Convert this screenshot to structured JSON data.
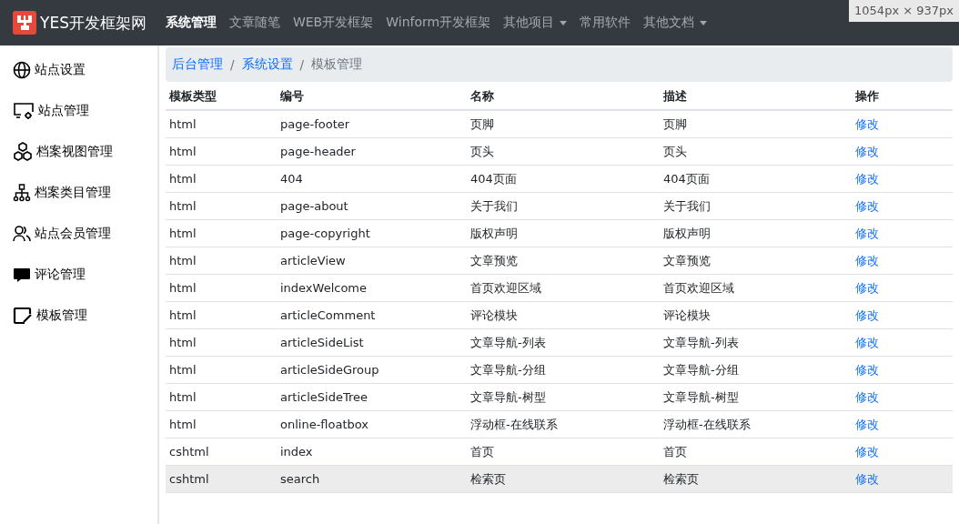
{
  "navbar": {
    "brand": "YES开发框架网",
    "items": [
      {
        "label": "系统管理",
        "selected": true,
        "dropdown": false
      },
      {
        "label": "文章随笔",
        "selected": false,
        "dropdown": false
      },
      {
        "label": "WEB开发框架",
        "selected": false,
        "dropdown": false
      },
      {
        "label": "Winform开发框架",
        "selected": false,
        "dropdown": false
      },
      {
        "label": "其他项目",
        "selected": false,
        "dropdown": true
      },
      {
        "label": "常用软件",
        "selected": false,
        "dropdown": false
      },
      {
        "label": "其他文档",
        "selected": false,
        "dropdown": true
      }
    ]
  },
  "size_tooltip": "1054px × 937px",
  "sidebar": {
    "items": [
      {
        "label": "站点设置",
        "kind": "globe"
      },
      {
        "label": "站点管理",
        "kind": "monitor"
      },
      {
        "label": "档案视图管理",
        "kind": "hexagons"
      },
      {
        "label": "档案类目管理",
        "kind": "tree"
      },
      {
        "label": "站点会员管理",
        "kind": "people"
      },
      {
        "label": "评论管理",
        "kind": "comment"
      },
      {
        "label": "模板管理",
        "kind": "edit"
      }
    ]
  },
  "breadcrumb": [
    {
      "label": "后台管理",
      "link": true
    },
    {
      "separator": "/",
      "label": "系统设置",
      "link": true
    },
    {
      "separator": "/",
      "label": "模板管理",
      "link": false
    }
  ],
  "table": {
    "columns": [
      "模板类型",
      "编号",
      "名称",
      "描述",
      "操作"
    ],
    "rows": [
      {
        "cells": [
          "html",
          "page-footer",
          "页脚",
          "页脚"
        ],
        "action": "修改",
        "selected": false
      },
      {
        "cells": [
          "html",
          "page-header",
          "页头",
          "页头"
        ],
        "action": "修改",
        "selected": false
      },
      {
        "cells": [
          "html",
          "404",
          "404页面",
          "404页面"
        ],
        "action": "修改",
        "selected": false
      },
      {
        "cells": [
          "html",
          "page-about",
          "关于我们",
          "关于我们"
        ],
        "action": "修改",
        "selected": false
      },
      {
        "cells": [
          "html",
          "page-copyright",
          "版权声明",
          "版权声明"
        ],
        "action": "修改",
        "selected": false
      },
      {
        "cells": [
          "html",
          "articleView",
          "文章预览",
          "文章预览"
        ],
        "action": "修改",
        "selected": false
      },
      {
        "cells": [
          "html",
          "indexWelcome",
          "首页欢迎区域",
          "首页欢迎区域"
        ],
        "action": "修改",
        "selected": false
      },
      {
        "cells": [
          "html",
          "articleComment",
          "评论模块",
          "评论模块"
        ],
        "action": "修改",
        "selected": false
      },
      {
        "cells": [
          "html",
          "articleSideList",
          "文章导航-列表",
          "文章导航-列表"
        ],
        "action": "修改",
        "selected": false
      },
      {
        "cells": [
          "html",
          "articleSideGroup",
          "文章导航-分组",
          "文章导航-分组"
        ],
        "action": "修改",
        "selected": false
      },
      {
        "cells": [
          "html",
          "articleSideTree",
          "文章导航-树型",
          "文章导航-树型"
        ],
        "action": "修改",
        "selected": false
      },
      {
        "cells": [
          "html",
          "online-floatbox",
          "浮动框-在线联系",
          "浮动框-在线联系"
        ],
        "action": "修改",
        "selected": false
      },
      {
        "cells": [
          "cshtml",
          "index",
          "首页",
          "首页"
        ],
        "action": "修改",
        "selected": false
      },
      {
        "cells": [
          "cshtml",
          "search",
          "检索页",
          "检索页"
        ],
        "action": "修改",
        "selected": true
      }
    ]
  }
}
